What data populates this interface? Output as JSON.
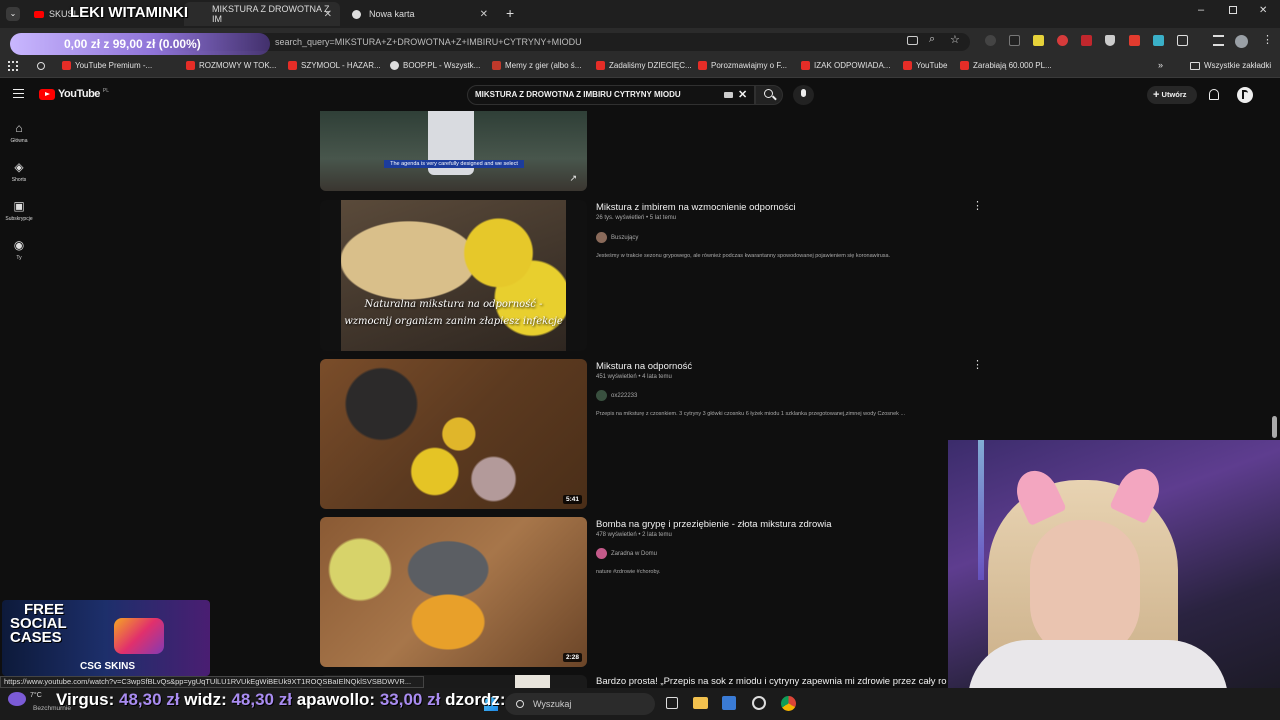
{
  "browser": {
    "tabs": [
      {
        "label": "SKUSI",
        "active": false
      },
      {
        "label": "MIKSTURA Z DROWOTNA Z IM",
        "active": true
      },
      {
        "label": "Nowa karta",
        "active": false
      }
    ],
    "url": "search_query=MIKSTURA+Z+DROWOTNA+Z+IMBIRU+CYTRYNY+MIODU",
    "bookmarks": [
      "YouTube Premium -...",
      "ROZMOWY W TOK...",
      "SZYMOOL - HAZAR...",
      "BOOP.PL - Wszystk...",
      "Memy z gier (albo ś...",
      "Zadaliśmy DZIECIĘC...",
      "Porozmawiajmy o F...",
      "IZAK ODPOWIADA...",
      "YouTube",
      "Zarabiają 60.000 PL..."
    ],
    "all_bookmarks": "Wszystkie zakładki",
    "status_url": "https://www.youtube.com/watch?v=C3wpSfBLvQs&pp=ygUqTUlLU1RVUkEgWiBEUk9XT1ROQSBaIElNQklSVSBDWVR..."
  },
  "youtube": {
    "logo": "YouTube",
    "region": "PL",
    "search_query": "MIKSTURA Z DROWOTNA Z IMBIRU CYTRYNY MIODU",
    "create_label": "Utwórz",
    "sidebar": [
      {
        "label": "Główna",
        "icon": "home-icon"
      },
      {
        "label": "Shorts",
        "icon": "shorts-icon"
      },
      {
        "label": "Subskrypcje",
        "icon": "subscriptions-icon"
      },
      {
        "label": "Ty",
        "icon": "you-icon"
      }
    ],
    "top_thumb_caption": "The agenda is very carefully designed and we select",
    "videos": [
      {
        "title": "Mikstura z imbirem na wzmocnienie odporności",
        "meta": "26 tys. wyświetleń • 5 lat temu",
        "channel": "Buszujący",
        "desc": "Jesteśmy w trakcie sezonu grypowego, ale również podczas kwarantanny spowodowanej pojawieniem się koronawirusa.",
        "thumb_text_1": "Naturalna mikstura na odporność -",
        "thumb_text_2": "wzmocnij organizm zanim złapiesz infekcje",
        "duration": ""
      },
      {
        "title": "Mikstura na odporność",
        "meta": "451 wyświetleń • 4 lata temu",
        "channel": "ox222233",
        "desc": "Przepis na miksturę z czosnkiem. 3 cytryny 3 główki czosnku 6 łyżek miodu 1 szklanka przegotowanej,zimnej wody Czosnek ...",
        "duration": "5:41"
      },
      {
        "title": "Bomba na grypę i przeziębienie - złota mikstura zdrowia",
        "meta": "478 wyświetleń • 2 lata temu",
        "channel": "Zaradna w Domu",
        "desc": "nature #zdrowie #choroby.",
        "duration": "2:28"
      },
      {
        "title": "Bardzo prosta! „Przepis na sok z miodu i cytryny zapewnia mi zdrowie przez cały ro"
      }
    ]
  },
  "stream": {
    "title": "LEKI WITAMINKI",
    "donation_goal": "0,00 zł z 99,00 zł (0.00%)",
    "promo_line1": "FREE",
    "promo_line2": "SOCIAL",
    "promo_line3": "CASES",
    "promo_brand": "CSG SKINS",
    "donors": [
      {
        "name": "Virgus:",
        "amount": "48,30 zł"
      },
      {
        "name": "widz:",
        "amount": "48,30 zł"
      },
      {
        "name": "apawollo:",
        "amount": "33,00 zł"
      },
      {
        "name": "dzordz:",
        "amount": ""
      }
    ],
    "taskbar_user": "Bezchmurnie",
    "taskbar_temp": "7°C",
    "taskbar_search": "Wyszukaj"
  },
  "colors": {
    "accent_red": "#ff0000",
    "donation_purple": "#a98cf0",
    "page_bg": "#0f0f0f"
  }
}
